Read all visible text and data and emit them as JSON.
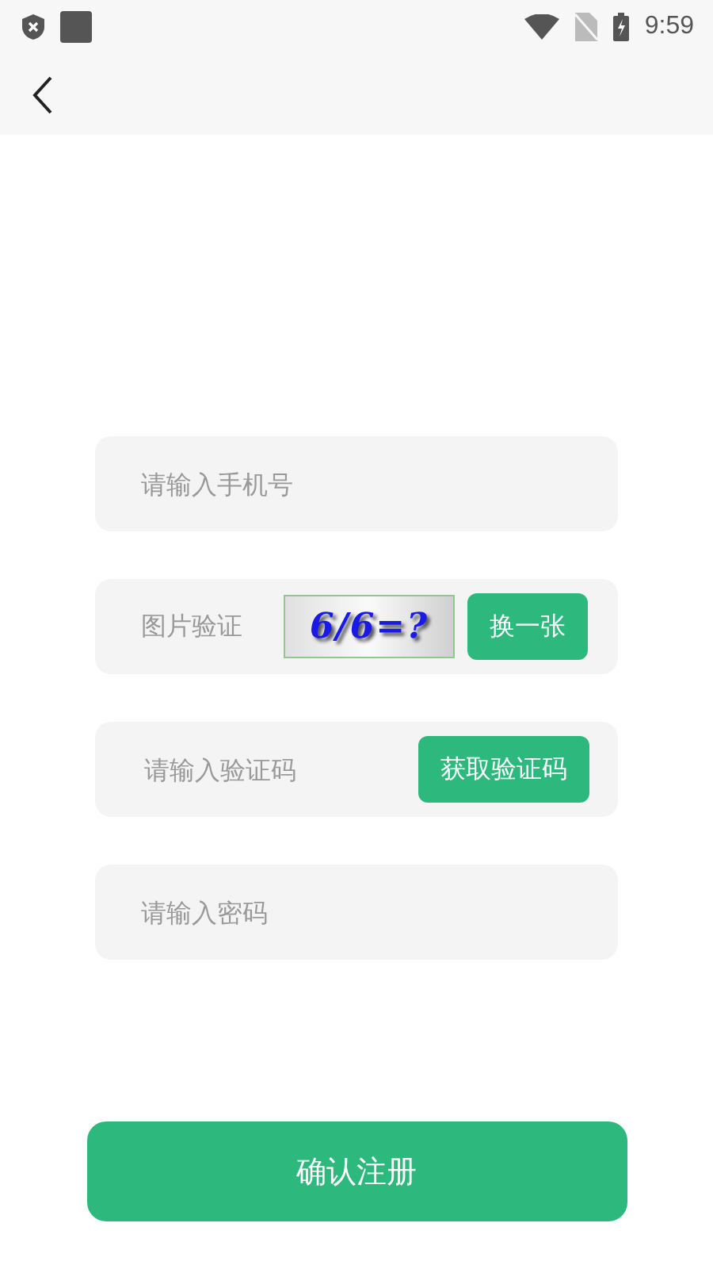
{
  "status_bar": {
    "time": "9:59"
  },
  "form": {
    "fields": [
      {
        "kind": "input",
        "placeholder": "请输入手机号"
      },
      {
        "kind": "captcha",
        "label": "图片验证",
        "captcha_text": "6/6=?",
        "button": "换一张"
      },
      {
        "kind": "code",
        "placeholder": "请输入验证码",
        "button": "获取验证码"
      },
      {
        "kind": "password",
        "placeholder": "请输入密码"
      }
    ]
  },
  "submit_button": "确认注册"
}
